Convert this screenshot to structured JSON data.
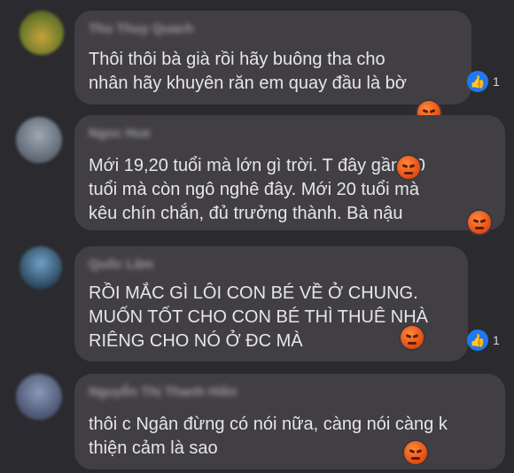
{
  "comments": [
    {
      "name": "Thu Thuy Quach",
      "text": "Thôi thôi bà già rồi hãy buông tha cho\nnhân hãy khuyên răn em quay đầu là bờ",
      "likes": "1"
    },
    {
      "name": "Ngoc Hue",
      "text": "Mới 19,20 tuổi mà lớn gì trời. T đây gần 30\ntuổi mà còn ngô nghê đây. Mới 20 tuổi mà\nkêu chín chắn, đủ trưởng thành. Bà nậu"
    },
    {
      "name": "Quốc Lâm",
      "text": "RỒI MẮC GÌ LÔI CON BÉ VỀ Ở CHUNG.\nMUỐN TỐT CHO CON BÉ THÌ THUÊ NHÀ\nRIÊNG CHO NÓ Ở ĐC MÀ",
      "likes": "1"
    },
    {
      "name": "Nguyễn Thị Thanh Hiền",
      "text": "thôi c Ngân đừng có nói nữa, càng nói càng k\nthiện cảm là sao"
    }
  ],
  "colors": {
    "background": "#2b2a2e",
    "bubble": "#423f44",
    "like": "#1f78f2",
    "angry": "#e24a12"
  },
  "icons": {
    "like": "thumbs-up-icon",
    "reaction": "angry-face-icon"
  }
}
